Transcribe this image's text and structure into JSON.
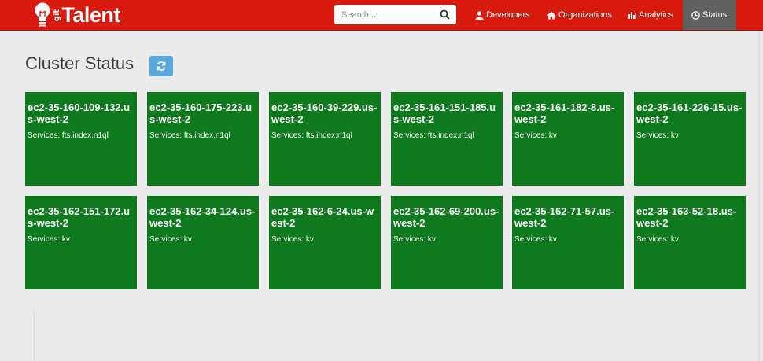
{
  "brand": {
    "prefix": "git",
    "name": "Talent"
  },
  "search": {
    "placeholder": "Search..."
  },
  "nav": [
    {
      "label": "Developers",
      "icon": "user-icon"
    },
    {
      "label": "Organizations",
      "icon": "home-icon"
    },
    {
      "label": "Analytics",
      "icon": "bar-chart-icon"
    },
    {
      "label": "Status",
      "icon": "clock-icon",
      "active": true
    }
  ],
  "page": {
    "title": "Cluster Status",
    "refresh_icon": "refresh-icon"
  },
  "services_prefix": "Services:",
  "nodes": [
    {
      "name": "ec2-35-160-109-132.us-west-2",
      "services": "fts,index,n1ql"
    },
    {
      "name": "ec2-35-160-175-223.us-west-2",
      "services": "fts,index,n1ql"
    },
    {
      "name": "ec2-35-160-39-229.us-west-2",
      "services": "fts,index,n1ql"
    },
    {
      "name": "ec2-35-161-151-185.us-west-2",
      "services": "fts,index,n1ql"
    },
    {
      "name": "ec2-35-161-182-8.us-west-2",
      "services": "kv"
    },
    {
      "name": "ec2-35-161-226-15.us-west-2",
      "services": "kv"
    },
    {
      "name": "ec2-35-162-151-172.us-west-2",
      "services": "kv"
    },
    {
      "name": "ec2-35-162-34-124.us-west-2",
      "services": "kv"
    },
    {
      "name": "ec2-35-162-6-24.us-west-2",
      "services": "kv"
    },
    {
      "name": "ec2-35-162-69-200.us-west-2",
      "services": "kv"
    },
    {
      "name": "ec2-35-162-71-57.us-west-2",
      "services": "kv"
    },
    {
      "name": "ec2-35-163-52-18.us-west-2",
      "services": "kv"
    }
  ],
  "colors": {
    "navbar": "#d7190e",
    "tile_ok": "#0e7a1d",
    "refresh_button": "#5aa9dc",
    "active_nav": "#616161"
  }
}
